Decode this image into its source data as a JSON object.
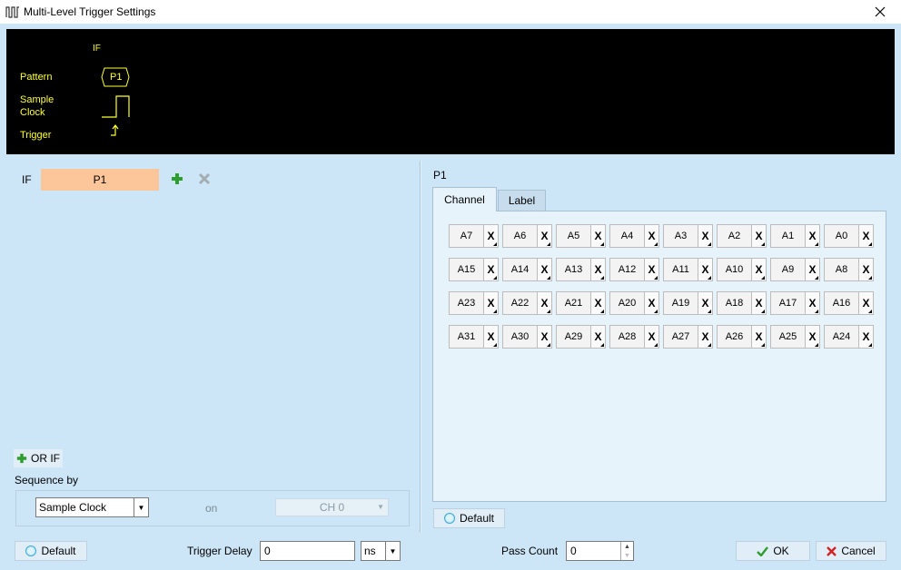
{
  "window": {
    "title": "Multi-Level Trigger Settings"
  },
  "preview": {
    "if_label": "IF",
    "pattern_label": "Pattern",
    "pattern_value": "P1",
    "sample_label_1": "Sample",
    "sample_label_2": "Clock",
    "trigger_label": "Trigger"
  },
  "left": {
    "if_label": "IF",
    "pattern_name": "P1",
    "or_if_label": "OR IF",
    "sequence_by_label": "Sequence by",
    "sequence_value": "Sample Clock",
    "on_label": "on",
    "channel_value": "CH 0"
  },
  "right": {
    "title": "P1",
    "tabs": [
      "Channel",
      "Label"
    ],
    "channel_rows": [
      [
        {
          "name": "A7",
          "value": "X"
        },
        {
          "name": "A6",
          "value": "X"
        },
        {
          "name": "A5",
          "value": "X"
        },
        {
          "name": "A4",
          "value": "X"
        },
        {
          "name": "A3",
          "value": "X"
        },
        {
          "name": "A2",
          "value": "X"
        },
        {
          "name": "A1",
          "value": "X"
        },
        {
          "name": "A0",
          "value": "X"
        }
      ],
      [
        {
          "name": "A15",
          "value": "X"
        },
        {
          "name": "A14",
          "value": "X"
        },
        {
          "name": "A13",
          "value": "X"
        },
        {
          "name": "A12",
          "value": "X"
        },
        {
          "name": "A11",
          "value": "X"
        },
        {
          "name": "A10",
          "value": "X"
        },
        {
          "name": "A9",
          "value": "X"
        },
        {
          "name": "A8",
          "value": "X"
        }
      ],
      [
        {
          "name": "A23",
          "value": "X"
        },
        {
          "name": "A22",
          "value": "X"
        },
        {
          "name": "A21",
          "value": "X"
        },
        {
          "name": "A20",
          "value": "X"
        },
        {
          "name": "A19",
          "value": "X"
        },
        {
          "name": "A18",
          "value": "X"
        },
        {
          "name": "A17",
          "value": "X"
        },
        {
          "name": "A16",
          "value": "X"
        }
      ],
      [
        {
          "name": "A31",
          "value": "X"
        },
        {
          "name": "A30",
          "value": "X"
        },
        {
          "name": "A29",
          "value": "X"
        },
        {
          "name": "A28",
          "value": "X"
        },
        {
          "name": "A27",
          "value": "X"
        },
        {
          "name": "A26",
          "value": "X"
        },
        {
          "name": "A25",
          "value": "X"
        },
        {
          "name": "A24",
          "value": "X"
        }
      ]
    ],
    "default_label": "Default"
  },
  "footer": {
    "default_label": "Default",
    "trigger_delay_label": "Trigger Delay",
    "trigger_delay_value": "0",
    "delay_unit": "ns",
    "pass_count_label": "Pass Count",
    "pass_count_value": "0",
    "ok_label": "OK",
    "cancel_label": "Cancel"
  },
  "colors": {
    "background": "#cce6f7",
    "preview_bg": "#000000",
    "preview_fg": "#ffff33",
    "pattern_box": "#fcc69a",
    "add_icon": "#2e9e2e",
    "cancel_icon": "#d32222"
  },
  "icons": [
    "app-signal-icon",
    "close-icon",
    "add-icon",
    "remove-icon",
    "radio-default-icon",
    "check-icon",
    "cross-icon"
  ]
}
